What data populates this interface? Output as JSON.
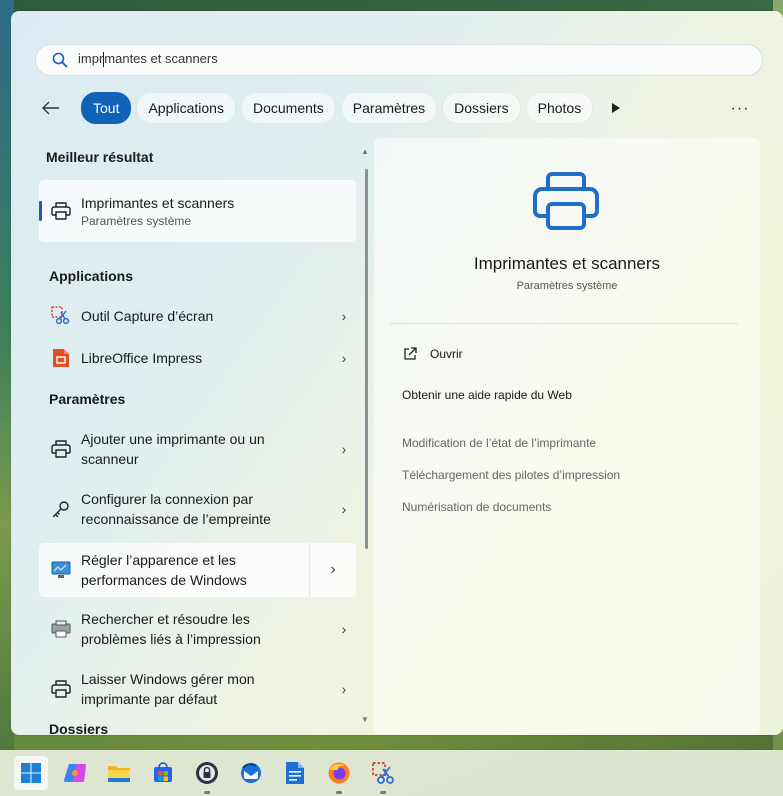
{
  "search": {
    "typed": "impr",
    "rest": "mantes et scanners"
  },
  "filters": [
    "Tout",
    "Applications",
    "Documents",
    "Paramètres",
    "Dossiers",
    "Photos"
  ],
  "more_label": "···",
  "best": {
    "section": "Meilleur résultat",
    "title": "Imprimantes et scanners",
    "subtitle": "Paramètres système"
  },
  "apps": {
    "section": "Applications",
    "items": [
      "Outil Capture d’écran",
      "LibreOffice Impress"
    ]
  },
  "settings": {
    "section": "Paramètres",
    "items": [
      [
        "Ajouter une imprimante ou un",
        "scanneur"
      ],
      [
        "Configurer la connexion par",
        "reconnaissance de l’empreinte"
      ],
      [
        "Régler l’apparence et les",
        "performances de Windows"
      ],
      [
        "Rechercher et résoudre les",
        "problèmes liés à l’impression"
      ],
      [
        "Laisser Windows gérer mon",
        "imprimante par défaut"
      ]
    ]
  },
  "folders": {
    "section": "Dossiers"
  },
  "detail": {
    "title": "Imprimantes et scanners",
    "subtitle": "Paramètres système",
    "open_label": "Ouvrir",
    "web_title": "Obtenir une aide rapide du Web",
    "web_links": [
      "Modification de l’état de l’imprimante",
      "Téléchargement des pilotes d’impression",
      "Numérisation de documents"
    ]
  },
  "colors": {
    "accent": "#0f62b8"
  },
  "taskbar_icons": [
    "start-icon",
    "copilot-icon",
    "file-explorer-icon",
    "store-icon",
    "password-manager-icon",
    "thunderbird-icon",
    "writer-icon",
    "firefox-icon",
    "snipping-tool-icon"
  ]
}
